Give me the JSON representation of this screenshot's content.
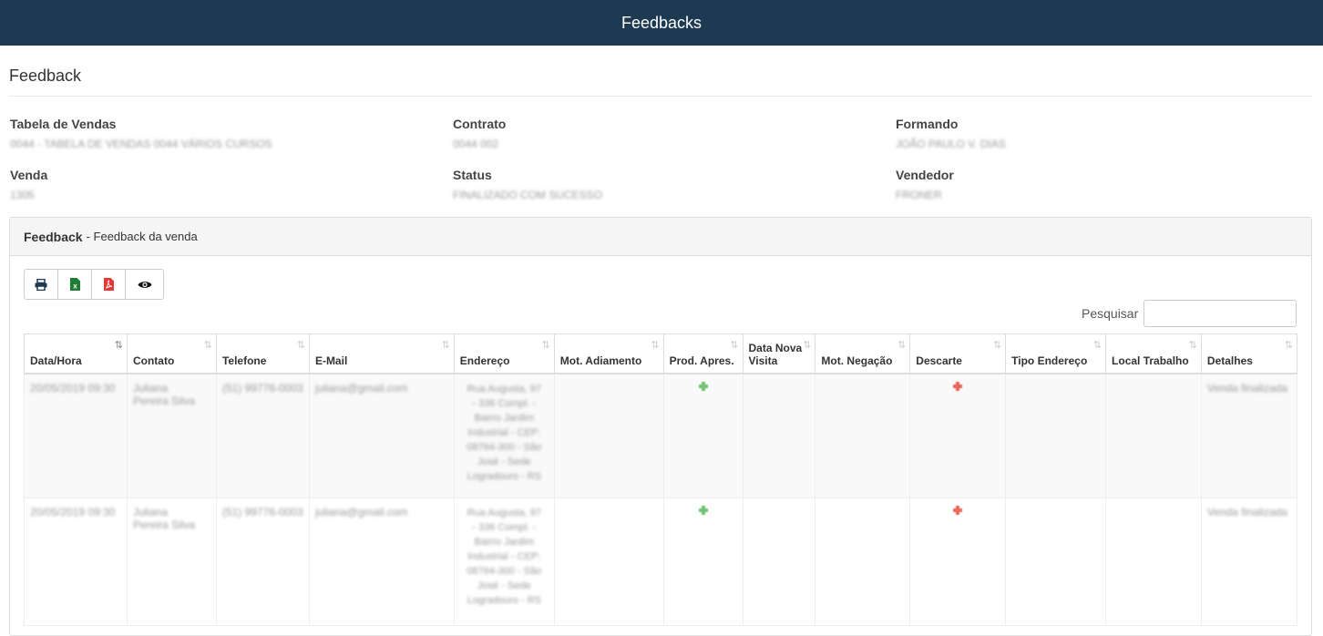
{
  "topbar": {
    "title": "Feedbacks"
  },
  "page": {
    "title": "Feedback"
  },
  "info": {
    "tabela_label": "Tabela de Vendas",
    "tabela_value": "0044 - TABELA DE VENDAS 0044 VÁRIOS CURSOS",
    "contrato_label": "Contrato",
    "contrato_value": "0044 002",
    "formando_label": "Formando",
    "formando_value": "JOÃO PAULO V. DIAS",
    "venda_label": "Venda",
    "venda_value": "1305",
    "status_label": "Status",
    "status_value": "FINALIZADO COM SUCESSO",
    "vendedor_label": "Vendedor",
    "vendedor_value": "FRONER"
  },
  "panel": {
    "title": "Feedback",
    "subtitle": "- Feedback da venda"
  },
  "toolbar": {
    "icons": [
      "print-icon",
      "excel-icon",
      "pdf-icon",
      "eye-icon"
    ]
  },
  "search": {
    "label": "Pesquisar",
    "value": ""
  },
  "table": {
    "headers": [
      "Data/Hora",
      "Contato",
      "Telefone",
      "E-Mail",
      "Endereço",
      "Mot. Adiamento",
      "Prod. Apres.",
      "Data Nova Visita",
      "Mot. Negação",
      "Descarte",
      "Tipo Endereço",
      "Local Trabalho",
      "Detalhes"
    ],
    "rows": [
      {
        "datahora": "20/05/2019 09:30",
        "contato": "Juliana Pereira Silva",
        "telefone": "(51) 99776-0003",
        "email": "juliana@gmail.com",
        "endereco": "Rua Augusta, 97 - 336 Compl. - Bairro Jardim Industrial - CEP: 08764-300 - São José - Sede Logradouro - RS",
        "detalhes": "Venda finalizada"
      },
      {
        "datahora": "20/05/2019 09:30",
        "contato": "Juliana Pereira Silva",
        "telefone": "(51) 99776-0003",
        "email": "juliana@gmail.com",
        "endereco": "Rua Augusta, 97 - 336 Compl. - Bairro Jardim Industrial - CEP: 08764-300 - São José - Sede Logradouro - RS",
        "detalhes": "Venda finalizada"
      }
    ]
  },
  "colors": {
    "topbar": "#1d3a52",
    "positive": "#5cb85c",
    "negative": "#e74c3c",
    "excel": "#1e7d32",
    "pdf": "#e53935"
  }
}
